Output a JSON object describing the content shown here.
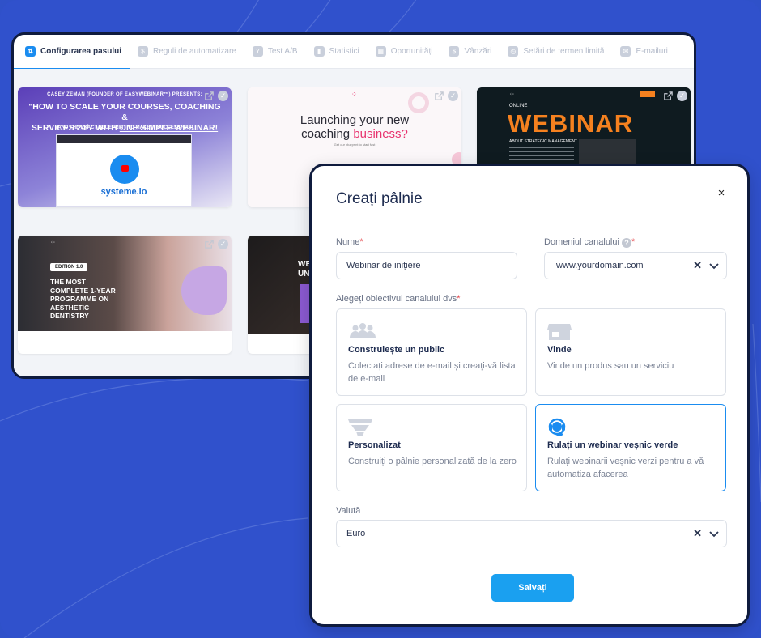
{
  "tabs": [
    {
      "label": "Configurarea pasului",
      "icon": "step-settings-icon",
      "active": true
    },
    {
      "label": "Reguli de automatizare",
      "icon": "automation-icon",
      "active": false
    },
    {
      "label": "Test A/B",
      "icon": "ab-test-icon",
      "active": false
    },
    {
      "label": "Statistici",
      "icon": "stats-icon",
      "active": false
    },
    {
      "label": "Oportunități",
      "icon": "opportunities-icon",
      "active": false
    },
    {
      "label": "Vânzări",
      "icon": "sales-icon",
      "active": false
    },
    {
      "label": "Setări de termen limită",
      "icon": "clock-icon",
      "active": false
    },
    {
      "label": "E-mailuri",
      "icon": "email-icon",
      "active": false
    }
  ],
  "thumbnails": {
    "t1": {
      "line1": "CASEY ZEMAN (FOUNDER OF EASYWEBINAR™) PRESENTS:",
      "line2a": "\"HOW TO SCALE YOUR COURSES, COACHING &",
      "line2b": "SERVICES 24/7 WITH ",
      "line2u": "ONE SIMPLE WEBINAR!",
      "line3": "(AND THE EXACT BLUEPRINT TO MAKE IT SUCCESSFUL!)",
      "logo": "systeme.io"
    },
    "t2": {
      "line1": "Launching your new",
      "line2a": "coaching ",
      "line2b": "business?",
      "sub": "Get our blueprint to start fast"
    },
    "t3": {
      "online": "ONLINE",
      "title": "WEBINAR",
      "about": "ABOUT STRATEGIC MANAGEMENT"
    },
    "t4": {
      "edition": "EDITION 1.0",
      "l1": "THE MOST",
      "l2": "COMPLETE 1-YEAR",
      "l3": "PROGRAMME ON",
      "l4": "AESTHETIC",
      "l5": "DENTISTRY"
    },
    "t5": {
      "l1": "WE",
      "l2": "UN"
    }
  },
  "modal": {
    "title": "Creați pâlnie",
    "close": "×",
    "name_label": "Nume",
    "name_value": "Webinar de inițiere",
    "domain_label": "Domeniul canalului",
    "domain_value": "www.yourdomain.com",
    "goal_label": "Alegeți obiectivul canalului dvs",
    "required_mark": "*",
    "help": "?",
    "goals": [
      {
        "title": "Construiește un public",
        "desc": "Colectați adrese de e-mail și creați-vă lista de e-mail",
        "icon": "audience-icon",
        "selected": false
      },
      {
        "title": "Vinde",
        "desc": "Vinde un produs sau un serviciu",
        "icon": "store-icon",
        "selected": false
      },
      {
        "title": "Personalizat",
        "desc": "Construiți o pâlnie personalizată de la zero",
        "icon": "funnel-icon",
        "selected": false
      },
      {
        "title": "Rulați un webinar veșnic verde",
        "desc": "Rulați webinarii veșnic verzi pentru a vă automatiza afacerea",
        "icon": "headset-icon",
        "selected": true
      }
    ],
    "currency_label": "Valută",
    "currency_value": "Euro",
    "save": "Salvați"
  },
  "colors": {
    "accent": "#1a8cf0",
    "background": "#3051cc",
    "title": "#1d2b4f",
    "required": "#e5484d"
  }
}
